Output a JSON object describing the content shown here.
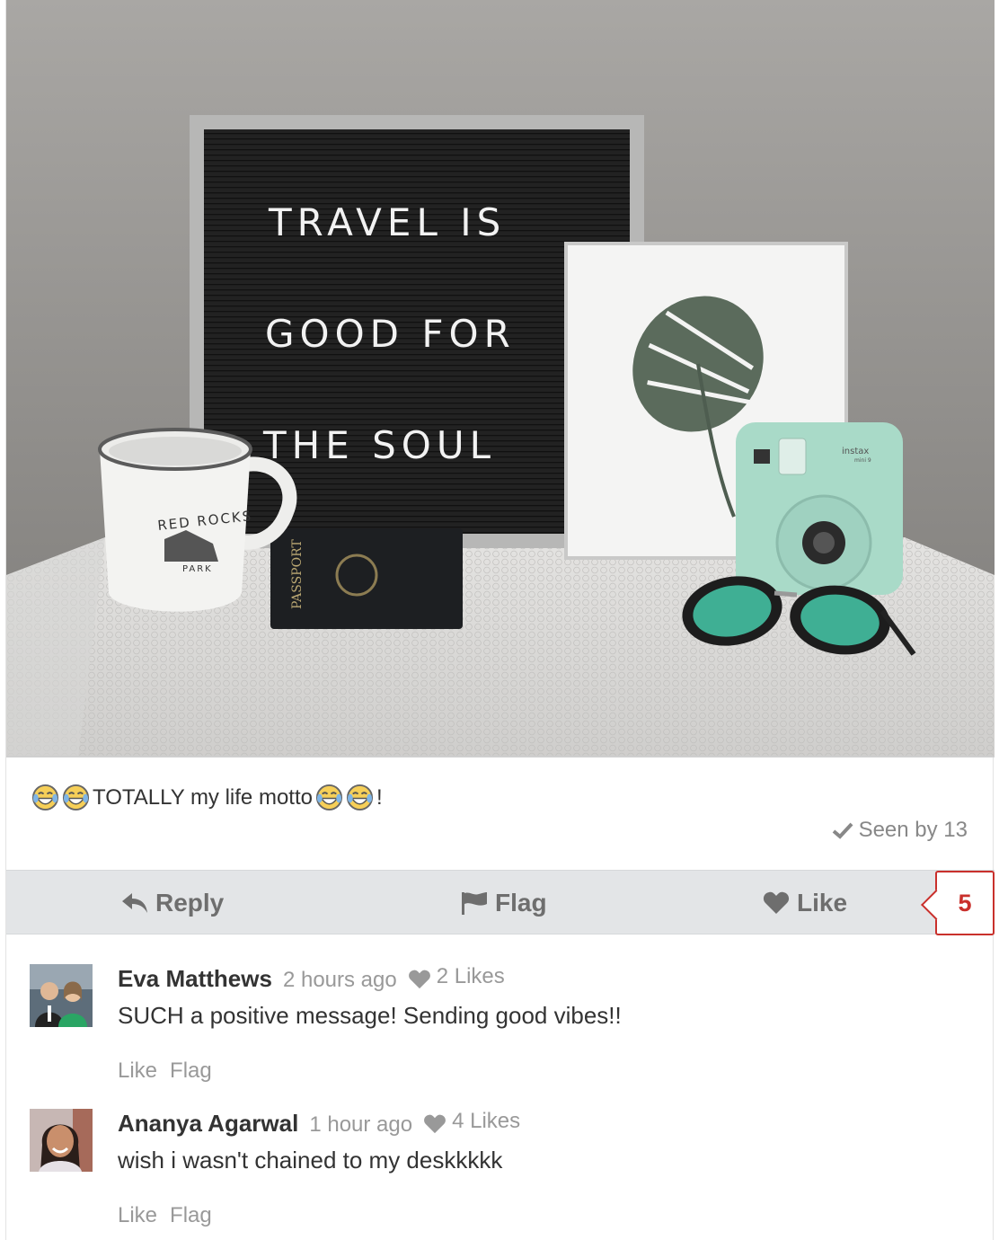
{
  "post": {
    "caption_text": "TOTALLY my life motto",
    "caption_suffix": "!",
    "seen_label": "Seen by 13",
    "photo": {
      "board_lines": [
        "TRAVEL IS",
        "GOOD FOR",
        "THE SOUL"
      ],
      "mug_text": "RED ROCKS",
      "mug_subtext": "PARK",
      "passport_text": "PASSPORT",
      "camera_brand": "instax",
      "camera_model": "mini 9"
    }
  },
  "actions": {
    "reply_label": "Reply",
    "flag_label": "Flag",
    "like_label": "Like",
    "like_count": "5"
  },
  "comments": [
    {
      "author": "Eva Matthews",
      "time": "2 hours ago",
      "likes": "2 Likes",
      "text": "SUCH a positive message! Sending good vibes!!",
      "like_action": "Like",
      "flag_action": "Flag"
    },
    {
      "author": "Ananya Agarwal",
      "time": "1 hour ago",
      "likes": "4 Likes",
      "text": "wish i wasn't chained to my deskkkkk",
      "like_action": "Like",
      "flag_action": "Flag"
    }
  ],
  "colors": {
    "accent": "#c9302c",
    "action_bar": "#e3e5e7",
    "muted_text": "#999999"
  },
  "icons": {
    "reply": "reply-arrow-icon",
    "flag": "flag-icon",
    "like": "heart-icon",
    "seen": "check-icon",
    "emoji": "tears-of-joy-emoji-icon"
  }
}
